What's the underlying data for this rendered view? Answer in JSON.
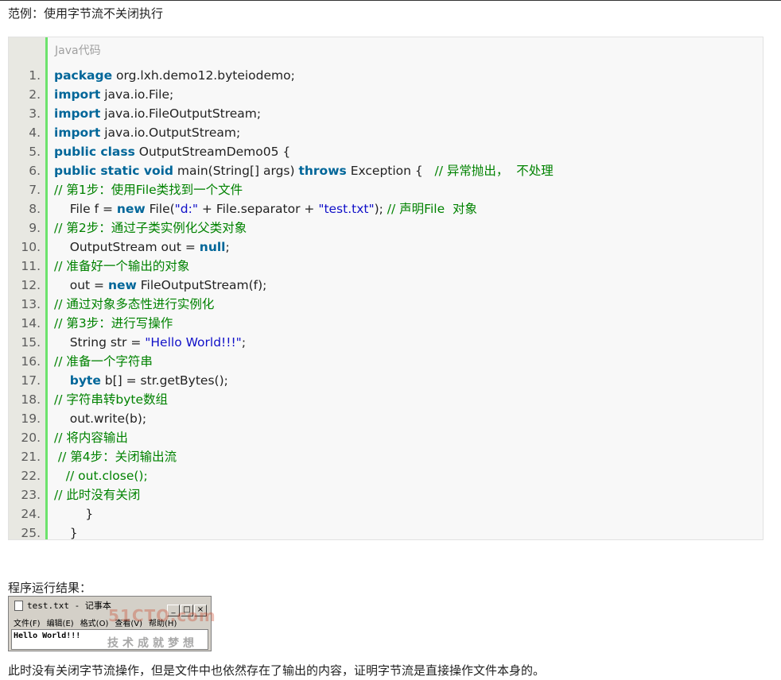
{
  "heading": "范例：使用字节流不关闭执行",
  "code_block": {
    "language_label": "Java代码",
    "lines": [
      {
        "num": "1.",
        "tokens": [
          {
            "t": "package",
            "c": "kw"
          },
          {
            "t": " org.lxh.demo12.byteiodemo;",
            "c": ""
          }
        ]
      },
      {
        "num": "2.",
        "tokens": [
          {
            "t": "import",
            "c": "kw"
          },
          {
            "t": " java.io.File;",
            "c": ""
          }
        ]
      },
      {
        "num": "3.",
        "tokens": [
          {
            "t": "import",
            "c": "kw"
          },
          {
            "t": " java.io.FileOutputStream;",
            "c": ""
          }
        ]
      },
      {
        "num": "4.",
        "tokens": [
          {
            "t": "import",
            "c": "kw"
          },
          {
            "t": " java.io.OutputStream;",
            "c": ""
          }
        ]
      },
      {
        "num": "5.",
        "tokens": [
          {
            "t": "public class",
            "c": "kw"
          },
          {
            "t": " OutputStreamDemo05 {",
            "c": ""
          }
        ]
      },
      {
        "num": "6.",
        "tokens": [
          {
            "t": "public static void",
            "c": "kw"
          },
          {
            "t": " main(String[] args) ",
            "c": ""
          },
          {
            "t": "throws",
            "c": "kw"
          },
          {
            "t": " Exception {   ",
            "c": ""
          },
          {
            "t": "// 异常抛出，  不处理",
            "c": "cm"
          }
        ]
      },
      {
        "num": "7.",
        "tokens": [
          {
            "t": "// 第1步：使用File类找到一个文件",
            "c": "cm"
          }
        ]
      },
      {
        "num": "8.",
        "tokens": [
          {
            "t": "    File f = ",
            "c": ""
          },
          {
            "t": "new",
            "c": "kw"
          },
          {
            "t": " File(",
            "c": ""
          },
          {
            "t": "\"d:\"",
            "c": "str"
          },
          {
            "t": " + File.separator + ",
            "c": ""
          },
          {
            "t": "\"test.txt\"",
            "c": "str"
          },
          {
            "t": "); ",
            "c": ""
          },
          {
            "t": "// 声明File  对象",
            "c": "cm"
          }
        ]
      },
      {
        "num": "9.",
        "tokens": [
          {
            "t": "// 第2步：通过子类实例化父类对象",
            "c": "cm"
          }
        ]
      },
      {
        "num": "10.",
        "tokens": [
          {
            "t": "    OutputStream out = ",
            "c": ""
          },
          {
            "t": "null",
            "c": "kw"
          },
          {
            "t": ";",
            "c": ""
          }
        ]
      },
      {
        "num": "11.",
        "tokens": [
          {
            "t": "// 准备好一个输出的对象",
            "c": "cm"
          }
        ]
      },
      {
        "num": "12.",
        "tokens": [
          {
            "t": "    out = ",
            "c": ""
          },
          {
            "t": "new",
            "c": "kw"
          },
          {
            "t": " FileOutputStream(f);",
            "c": ""
          }
        ]
      },
      {
        "num": "13.",
        "tokens": [
          {
            "t": "// 通过对象多态性进行实例化",
            "c": "cm"
          }
        ]
      },
      {
        "num": "14.",
        "tokens": [
          {
            "t": "// 第3步：进行写操作",
            "c": "cm"
          }
        ]
      },
      {
        "num": "15.",
        "tokens": [
          {
            "t": "    String str = ",
            "c": ""
          },
          {
            "t": "\"Hello World!!!\"",
            "c": "str"
          },
          {
            "t": ";",
            "c": ""
          }
        ]
      },
      {
        "num": "16.",
        "tokens": [
          {
            "t": "// 准备一个字符串",
            "c": "cm"
          }
        ]
      },
      {
        "num": "17.",
        "tokens": [
          {
            "t": "    ",
            "c": ""
          },
          {
            "t": "byte",
            "c": "kw"
          },
          {
            "t": " b[] = str.getBytes();",
            "c": ""
          }
        ]
      },
      {
        "num": "18.",
        "tokens": [
          {
            "t": "// 字符串转byte数组",
            "c": "cm"
          }
        ]
      },
      {
        "num": "19.",
        "tokens": [
          {
            "t": "    out.write(b);",
            "c": ""
          }
        ]
      },
      {
        "num": "20.",
        "tokens": [
          {
            "t": "// 将内容输出",
            "c": "cm"
          }
        ]
      },
      {
        "num": "21.",
        "tokens": [
          {
            "t": " // 第4步：关闭输出流",
            "c": "cm"
          }
        ]
      },
      {
        "num": "22.",
        "tokens": [
          {
            "t": "   // out.close();",
            "c": "cm"
          }
        ]
      },
      {
        "num": "23.",
        "tokens": [
          {
            "t": "// 此时没有关闭",
            "c": "cm"
          }
        ]
      },
      {
        "num": "24.",
        "tokens": [
          {
            "t": "        }",
            "c": ""
          }
        ]
      },
      {
        "num": "25.",
        "tokens": [
          {
            "t": "    }",
            "c": ""
          }
        ]
      }
    ]
  },
  "result_label": "程序运行结果：",
  "notepad": {
    "title": "test.txt - 记事本",
    "buttons": [
      "_",
      "□",
      "×"
    ],
    "menu": [
      "文件(F)",
      "编辑(E)",
      "格式(O)",
      "查看(V)",
      "帮助(H)"
    ],
    "content": "Hello World!!!",
    "watermark_logo": "51CTO.com",
    "watermark_slogan": "技术成就梦想"
  },
  "footer": "此时没有关闭字节流操作，但是文件中也依然存在了输出的内容，证明字节流是直接操作文件本身的。"
}
